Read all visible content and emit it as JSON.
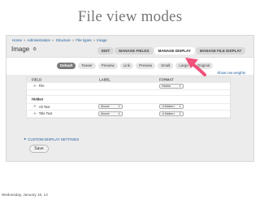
{
  "slide": {
    "title": "File view modes"
  },
  "breadcrumb": {
    "items": [
      "Home",
      "Administration",
      "Structure",
      "File types",
      "Image"
    ],
    "separator": "»"
  },
  "page": {
    "title": "Image",
    "gear_icon": "gear-icon"
  },
  "primary_tabs": [
    {
      "label": "EDIT",
      "active": false
    },
    {
      "label": "MANAGE FIELDS",
      "active": false
    },
    {
      "label": "MANAGE DISPLAY",
      "active": true
    },
    {
      "label": "MANAGE FILE DISPLAY",
      "active": false
    }
  ],
  "view_modes": [
    {
      "label": "Default",
      "active": true
    },
    {
      "label": "Teaser",
      "active": false
    },
    {
      "label": "Preview",
      "active": false
    },
    {
      "label": "Link",
      "active": false
    },
    {
      "label": "Preview",
      "active": false
    },
    {
      "label": "Small",
      "active": false
    },
    {
      "label": "Large",
      "active": false
    },
    {
      "label": "Original",
      "active": false
    }
  ],
  "row_weights_link": "Show row weights",
  "table": {
    "headers": {
      "field": "FIELD",
      "label": "LABEL",
      "format": "FORMAT"
    },
    "rows": [
      {
        "field": "File",
        "label": "",
        "format": "Visible"
      },
      {
        "region": "Hidden"
      },
      {
        "field": "Alt Text",
        "label": "Above",
        "format": "<Hidden>"
      },
      {
        "field": "Title Text",
        "label": "Above",
        "format": "<Hidden>"
      }
    ]
  },
  "custom_settings": "CUSTOM DISPLAY SETTINGS",
  "save_label": "Save",
  "footer_date": "Wednesday, January 15, 14",
  "colors": {
    "arrow": "#f0507a",
    "link": "#1a5a9a",
    "active_tab": "#7a7a7a"
  }
}
